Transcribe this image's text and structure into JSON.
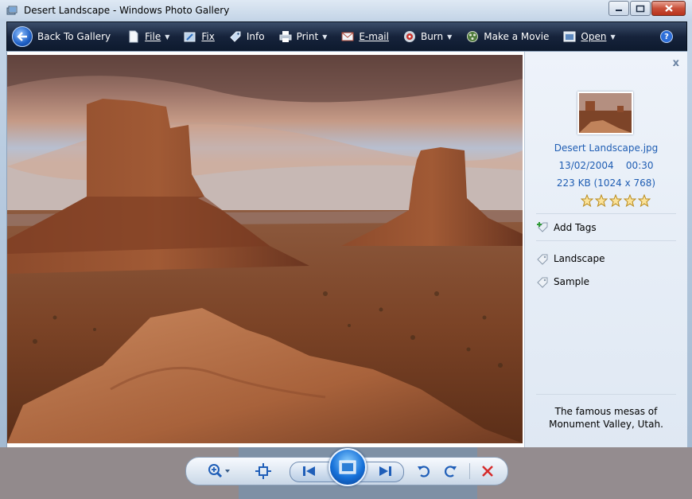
{
  "window": {
    "title": "Desert Landscape - Windows Photo Gallery"
  },
  "toolbar": {
    "back": "Back To Gallery",
    "file": "File",
    "fix": "Fix",
    "info": "Info",
    "print": "Print",
    "email": "E-mail",
    "burn": "Burn",
    "movie": "Make a Movie",
    "open": "Open",
    "help": "?"
  },
  "info_pane": {
    "close": "x",
    "filename": "Desert Landscape.jpg",
    "date": "13/02/2004",
    "time": "00:30",
    "size": "223 KB (1024 x 768)",
    "rating": 0,
    "add_tags": "Add Tags",
    "tags": [
      "Landscape",
      "Sample"
    ],
    "caption": "The famous mesas of Monument Valley, Utah."
  },
  "colors": {
    "toolbar": "#16233b",
    "link": "#1f5db3",
    "delete": "#d62b2b"
  }
}
